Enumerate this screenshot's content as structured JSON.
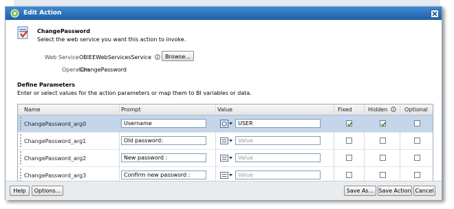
{
  "dialog": {
    "title": "Edit Action",
    "action_name": "ChangePassword",
    "subtitle": "Select the web service you want this action to invoke.",
    "web_service_label": "Web Service",
    "web_service_value": "OBIEEWebServicesService",
    "browse_label": "Browse...",
    "operation_label": "Operation",
    "operation_value": "ChangePassword",
    "define_title": "Define Parameters",
    "define_desc": "Enter or select values for the action parameters or map them to BI variables or data."
  },
  "table": {
    "columns": {
      "name": "Name",
      "prompt": "Prompt",
      "value": "Value",
      "fixed": "Fixed",
      "hidden": "Hidden",
      "optional": "Optional"
    },
    "rows": [
      {
        "name": "ChangePassword_arg0",
        "prompt": "Username",
        "value": "USER",
        "value_placeholder": "",
        "fixed": true,
        "hidden": true,
        "optional": false,
        "value_type_icon": "session-variable-icon"
      },
      {
        "name": "ChangePassword_arg1",
        "prompt": "Old password:",
        "value": "",
        "value_placeholder": "Value",
        "fixed": false,
        "hidden": false,
        "optional": false,
        "value_type_icon": "value-type-icon"
      },
      {
        "name": "ChangePassword_arg2",
        "prompt": "New password :",
        "value": "",
        "value_placeholder": "Value",
        "fixed": false,
        "hidden": false,
        "optional": false,
        "value_type_icon": "value-type-icon"
      },
      {
        "name": "ChangePassword_arg3",
        "prompt": "Confirm new password :",
        "value": "",
        "value_placeholder": "Value",
        "fixed": false,
        "hidden": false,
        "optional": false,
        "value_type_icon": "value-type-icon"
      }
    ]
  },
  "footer": {
    "help": "Help",
    "options": "Options...",
    "save_as": "Save As...",
    "save_action": "Save Action",
    "cancel": "Cancel"
  },
  "colors": {
    "titlebar": "#2b6fbd",
    "selected_row": "#c5d5ea",
    "checkmark": "#2f8a2f"
  }
}
